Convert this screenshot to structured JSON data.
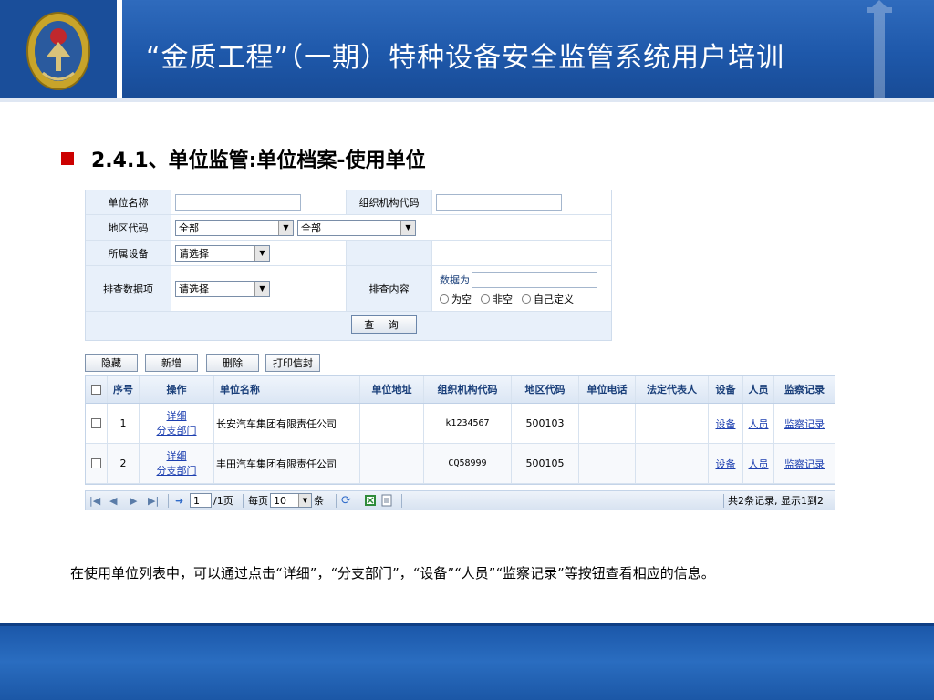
{
  "header": {
    "title": "“金质工程”（一期）特种设备安全监管系统用户培训",
    "logo_icon": "emblem-icon"
  },
  "section": {
    "title": "2.4.1、单位监管:单位档案-使用单位"
  },
  "form": {
    "unit_name_label": "单位名称",
    "org_code_label": "组织机构代码",
    "region_label": "地区代码",
    "region_select_1": "全部",
    "region_select_2": "全部",
    "device_label": "所属设备",
    "device_select": "请选择",
    "check_item_label": "排查数据项",
    "check_item_select": "请选择",
    "check_content_label": "排查内容",
    "data_is_label": "数据为",
    "radio_empty": "为空",
    "radio_not_empty": "非空",
    "radio_custom": "自己定义",
    "query_button": "查 询"
  },
  "toolbar": {
    "hide_label": "隐藏",
    "add_label": "新增",
    "delete_label": "删除",
    "print_label": "打印信封"
  },
  "grid": {
    "headers": {
      "seq": "序号",
      "ops": "操作",
      "name": "单位名称",
      "address": "单位地址",
      "org_code": "组织机构代码",
      "region": "地区代码",
      "phone": "单位电话",
      "legal_rep": "法定代表人",
      "device": "设备",
      "staff": "人员",
      "inspection": "监察记录"
    },
    "rows": [
      {
        "seq": "1",
        "detail": "详细",
        "branch": "分支部门",
        "name": "长安汽车集团有限责任公司",
        "address": "",
        "org_code": "k1234567",
        "region": "500103",
        "phone": "",
        "legal_rep": "",
        "device": "设备",
        "staff": "人员",
        "inspection": "监察记录"
      },
      {
        "seq": "2",
        "detail": "详细",
        "branch": "分支部门",
        "name": "丰田汽车集团有限责任公司",
        "address": "",
        "org_code": "CQ58999",
        "region": "500105",
        "phone": "",
        "legal_rep": "",
        "device": "设备",
        "staff": "人员",
        "inspection": "监察记录"
      }
    ]
  },
  "pager": {
    "page_value": "1",
    "page_total": "/1页",
    "per_page_label": "每页",
    "per_page_value": "10",
    "per_page_unit": "条",
    "summary": "共2条记录, 显示1到2"
  },
  "description": "在使用单位列表中，可以通过点击“详细”，“分支部门”，“设备”“人员”“监察记录”等按钮查看相应的信息。"
}
